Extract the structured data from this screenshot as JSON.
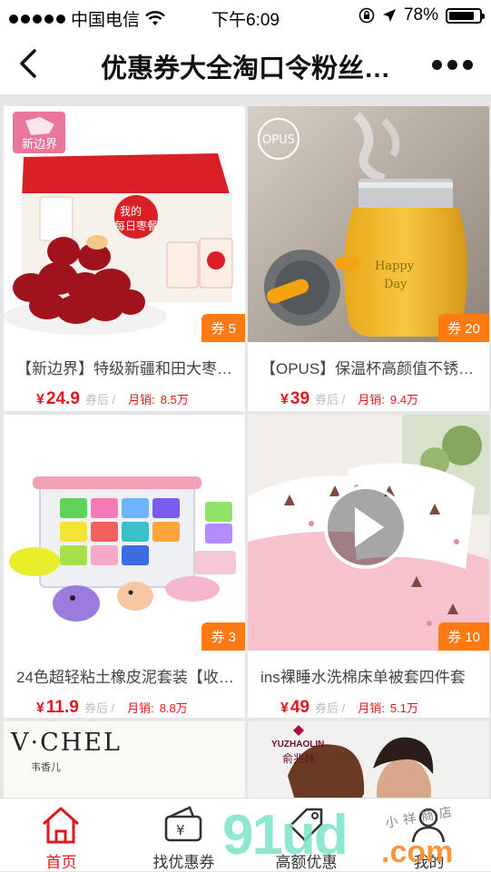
{
  "status_bar": {
    "carrier": "中国电信",
    "time": "下午6:09",
    "battery": "78%"
  },
  "nav": {
    "title": "优惠券大全淘口令粉丝…"
  },
  "products": [
    {
      "title": "【新边界】特级新疆和田大枣…",
      "coupon": "券 5",
      "price": "24.9",
      "after": "券后 /",
      "sales_label": "月销:",
      "sales": "8.5万",
      "brand": "新边界"
    },
    {
      "title": "【OPUS】保温杯高颜值不锈…",
      "coupon": "券 20",
      "price": "39",
      "after": "券后 /",
      "sales_label": "月销:",
      "sales": "9.4万",
      "brand": "OPUS"
    },
    {
      "title": "24色超轻粘土橡皮泥套装【收…",
      "coupon": "券 3",
      "price": "11.9",
      "after": "券后 /",
      "sales_label": "月销:",
      "sales": "8.8万"
    },
    {
      "title": "ins裸睡水洗棉床单被套四件套",
      "coupon": "券 10",
      "price": "49",
      "after": "券后 /",
      "sales_label": "月销:",
      "sales": "5.1万"
    },
    {
      "brand": "V·CHEL",
      "brand_sub": "韦香儿"
    },
    {
      "brand": "YUZHAOLIN",
      "brand_sub": "俞兆林"
    }
  ],
  "currency": "¥",
  "tabs": [
    {
      "label": "首页",
      "icon": "home-icon",
      "active": true
    },
    {
      "label": "找优惠券",
      "icon": "wallet-icon",
      "active": false
    },
    {
      "label": "高额优惠",
      "icon": "tag-icon",
      "active": false
    },
    {
      "label": "我的",
      "icon": "user-icon",
      "active": false
    }
  ],
  "watermark": {
    "main": "91ud",
    "suffix": ".com",
    "small": "小祥商店"
  },
  "colors": {
    "accent": "#e0181b",
    "coupon": "#ff7a12"
  }
}
